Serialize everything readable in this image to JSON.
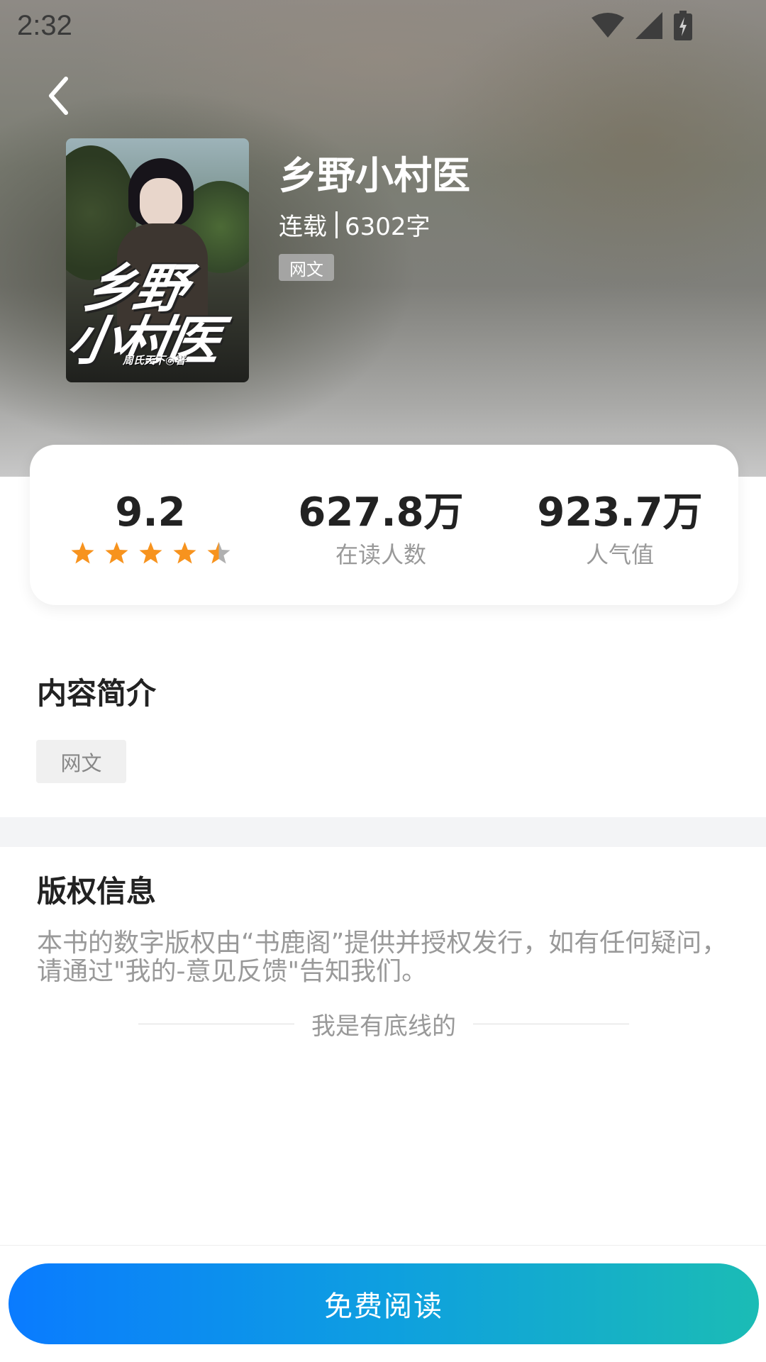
{
  "status_bar": {
    "time": "2:32",
    "icons": [
      "wifi-icon",
      "signal-icon",
      "battery-charging-icon"
    ]
  },
  "header": {
    "back_icon": "chevron-left-icon"
  },
  "book": {
    "cover_title_line1": "乡野",
    "cover_title_line2": "小村医",
    "cover_author": "周氏天下◎著",
    "title": "乡野小村医",
    "status": "连载",
    "word_count": "6302字",
    "tag": "网文"
  },
  "stats": {
    "rating": {
      "value": "9.2",
      "stars": 4.5
    },
    "readers": {
      "value": "627.8万",
      "label": "在读人数"
    },
    "popularity": {
      "value": "923.7万",
      "label": "人气值"
    }
  },
  "intro": {
    "title": "内容简介",
    "tag": "网文"
  },
  "copyright": {
    "title": "版权信息",
    "text": "本书的数字版权由“书鹿阁”提供并授权发行，如有任何疑问，请通过\"我的-意见反馈\"告知我们。",
    "bottom_note": "我是有底线的"
  },
  "action": {
    "read_label": "免费阅读"
  },
  "colors": {
    "star": "#f7931e",
    "star_empty": "#b0b0b0",
    "button_gradient_start": "#0a7bff",
    "button_gradient_end": "#1bbcb5"
  }
}
